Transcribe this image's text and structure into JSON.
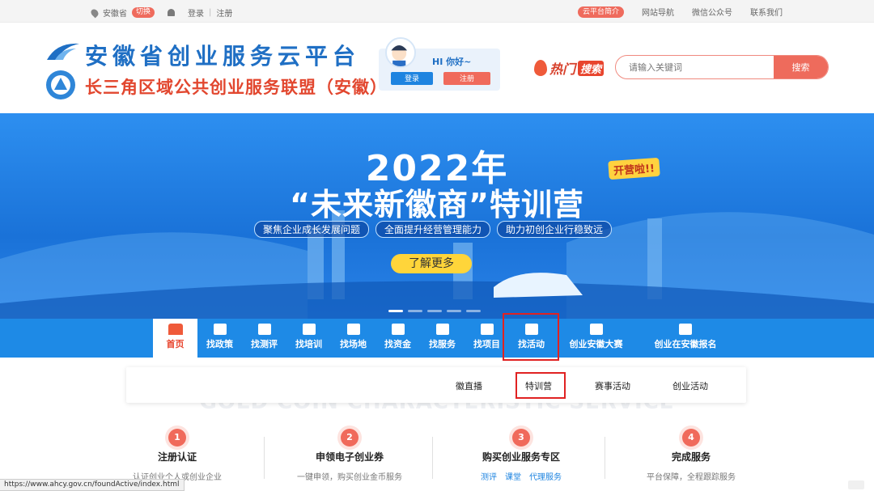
{
  "topbar": {
    "location": "安徽省",
    "switch": "切换",
    "login": "登录",
    "separator": "|",
    "register": "注册",
    "links": [
      "云平台简介",
      "网站导航",
      "微信公众号",
      "联系我们"
    ]
  },
  "header": {
    "title": "安徽省创业服务云平台",
    "subtitle": "长三角区域公共创业服务联盟（安徽）",
    "greeting": "HI 你好~",
    "login_button": "登录",
    "register_button": "注册",
    "hot_label_1": "热门",
    "hot_label_2": "搜索",
    "search_placeholder": "请输入关键词",
    "search_button": "搜索"
  },
  "banner": {
    "year": "2022年",
    "headline": "“未来新徽商”特训营",
    "badge": "开营啦!!",
    "pills": [
      "聚焦企业成长发展问题",
      "全面提升经营管理能力",
      "助力初创企业行稳致远"
    ],
    "more_button": "了解更多"
  },
  "nav": {
    "items": [
      "首页",
      "找政策",
      "找测评",
      "找培训",
      "找场地",
      "找资金",
      "找服务",
      "找项目",
      "找活动",
      "创业安徽大赛",
      "创业在安徽报名"
    ],
    "active": "首页"
  },
  "submenu": {
    "items": [
      "徽直播",
      "特训营",
      "赛事活动",
      "创业活动"
    ]
  },
  "section_bg_title": "GOLD COIN CHARACTERISTIC SERVICE",
  "steps": [
    {
      "num": "1",
      "name": "注册认证",
      "desc": "认证创业个人或创业企业"
    },
    {
      "num": "2",
      "name": "申领电子创业券",
      "desc": "一键申领，购买创业金币服务"
    },
    {
      "num": "3",
      "name": "购买创业服务专区",
      "links": [
        "测评",
        "课堂",
        "代理服务"
      ]
    },
    {
      "num": "4",
      "name": "完成服务",
      "desc": "平台保障，全程跟踪服务"
    }
  ],
  "statusbar": "https://www.ahcy.gov.cn/foundActive/index.html",
  "colors": {
    "brand_blue": "#1e8ae6",
    "accent_red": "#ee6b5c",
    "highlight": "#e02222"
  }
}
